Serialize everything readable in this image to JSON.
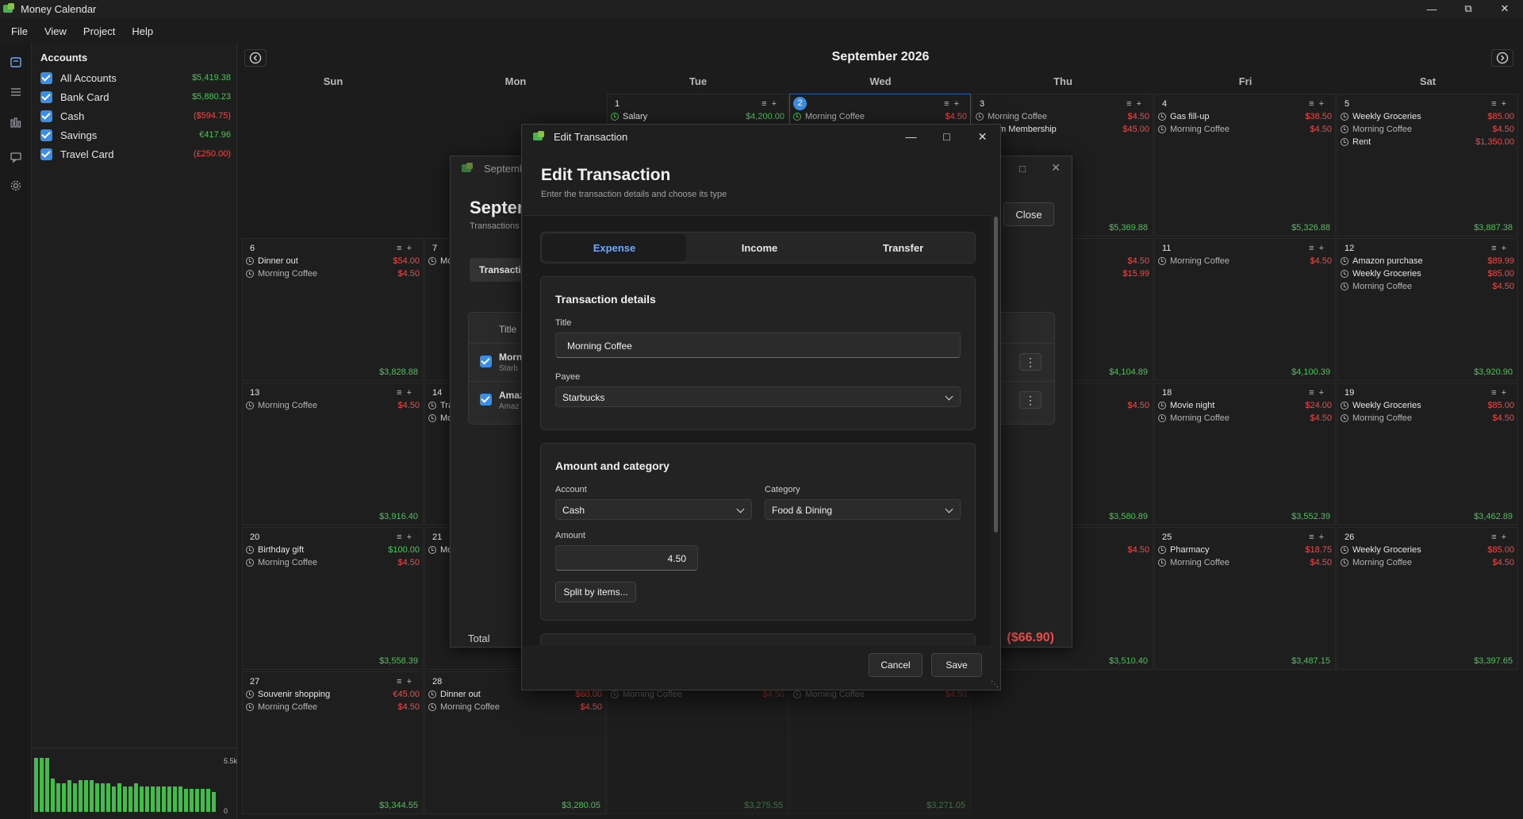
{
  "app": {
    "title": "Money Calendar"
  },
  "menu": [
    "File",
    "View",
    "Project",
    "Help"
  ],
  "rail_icons": [
    "calendar-icon",
    "list-icon",
    "chart-icon",
    "chat-icon",
    "settings-icon"
  ],
  "accounts": {
    "header": "Accounts",
    "items": [
      {
        "name": "All Accounts",
        "balance": "$5,419.38",
        "status": "pos"
      },
      {
        "name": "Bank Card",
        "balance": "$5,880.23",
        "status": "pos"
      },
      {
        "name": "Cash",
        "balance": "($594.75)",
        "status": "neg"
      },
      {
        "name": "Savings",
        "balance": "€417.96",
        "status": "pos"
      },
      {
        "name": "Travel Card",
        "balance": "(£250.00)",
        "status": "neg"
      }
    ],
    "mini_chart": {
      "top_label": "5.5k",
      "bottom_label": "0",
      "values": [
        0.94,
        0.94,
        0.94,
        0.58,
        0.5,
        0.5,
        0.55,
        0.5,
        0.55,
        0.55,
        0.55,
        0.5,
        0.5,
        0.5,
        0.45,
        0.5,
        0.45,
        0.45,
        0.5,
        0.45,
        0.45,
        0.45,
        0.45,
        0.45,
        0.45,
        0.45,
        0.45,
        0.4,
        0.4,
        0.4,
        0.4,
        0.4,
        0.35
      ]
    }
  },
  "calendar": {
    "month_title": "September 2026",
    "days_of_week": [
      "Sun",
      "Mon",
      "Tue",
      "Wed",
      "Thu",
      "Fri",
      "Sat"
    ],
    "weeks": [
      [
        null,
        null,
        {
          "day": "1",
          "tx": [
            {
              "t": "Salary",
              "a": "$4,200.00",
              "s": "pos",
              "done": true
            }
          ],
          "bal": ""
        },
        {
          "day": "2",
          "today": true,
          "tx": [
            {
              "t": "Morning Coffee",
              "a": "$4.50",
              "s": "neg",
              "done": true
            }
          ],
          "bal": ""
        },
        {
          "day": "3",
          "tx": [
            {
              "t": "Morning Coffee",
              "a": "$4.50",
              "s": "neg"
            },
            {
              "t": "Gym Membership",
              "a": "$45.00",
              "s": "neg"
            }
          ],
          "bal": "$5,369.88"
        },
        {
          "day": "4",
          "tx": [
            {
              "t": "Gas fill-up",
              "a": "$38.50",
              "s": "neg"
            },
            {
              "t": "Morning Coffee",
              "a": "$4.50",
              "s": "neg"
            }
          ],
          "bal": "$5,326.88"
        },
        {
          "day": "5",
          "tx": [
            {
              "t": "Weekly Groceries",
              "a": "$85.00",
              "s": "neg"
            },
            {
              "t": "Morning Coffee",
              "a": "$4.50",
              "s": "neg"
            },
            {
              "t": "Rent",
              "a": "$1,350.00",
              "s": "neg"
            }
          ],
          "bal": "$3,887.38"
        }
      ],
      [
        {
          "day": "6",
          "tx": [
            {
              "t": "Dinner out",
              "a": "$54.00",
              "s": "neg"
            },
            {
              "t": "Morning Coffee",
              "a": "$4.50",
              "s": "neg"
            }
          ],
          "bal": "$3,828.88"
        },
        {
          "day": "7",
          "tx": [
            {
              "t": "Mo",
              "a": "",
              "s": "neg"
            }
          ],
          "bal": ""
        },
        null,
        null,
        {
          "day": "",
          "tx": [
            {
              "t": "",
              "a": "$4.50",
              "s": "neg"
            },
            {
              "t": "n",
              "a": "$15.99",
              "s": "neg"
            }
          ],
          "bal": "$4,104.89"
        },
        {
          "day": "11",
          "tx": [
            {
              "t": "Morning Coffee",
              "a": "$4.50",
              "s": "neg"
            }
          ],
          "bal": "$4,100.39"
        },
        {
          "day": "12",
          "tx": [
            {
              "t": "Amazon purchase",
              "a": "$89.99",
              "s": "neg"
            },
            {
              "t": "Weekly Groceries",
              "a": "$85.00",
              "s": "neg"
            },
            {
              "t": "Morning Coffee",
              "a": "$4.50",
              "s": "neg"
            }
          ],
          "bal": "$3,920.90"
        }
      ],
      [
        {
          "day": "13",
          "tx": [
            {
              "t": "Morning Coffee",
              "a": "$4.50",
              "s": "neg"
            }
          ],
          "bal": "$3,916.40"
        },
        {
          "day": "14",
          "tx": [
            {
              "t": "Tra",
              "a": "",
              "s": "neg"
            },
            {
              "t": "Mo",
              "a": "",
              "s": "neg"
            }
          ],
          "bal": ""
        },
        null,
        null,
        {
          "day": "",
          "tx": [
            {
              "t": "",
              "a": "$4.50",
              "s": "neg"
            }
          ],
          "bal": "$3,580.89"
        },
        {
          "day": "18",
          "tx": [
            {
              "t": "Movie night",
              "a": "$24.00",
              "s": "neg"
            },
            {
              "t": "Morning Coffee",
              "a": "$4.50",
              "s": "neg"
            }
          ],
          "bal": "$3,552.39"
        },
        {
          "day": "19",
          "tx": [
            {
              "t": "Weekly Groceries",
              "a": "$85.00",
              "s": "neg"
            },
            {
              "t": "Morning Coffee",
              "a": "$4.50",
              "s": "neg"
            }
          ],
          "bal": "$3,462.89"
        }
      ],
      [
        {
          "day": "20",
          "tx": [
            {
              "t": "Birthday gift",
              "a": "$100.00",
              "s": "pos"
            },
            {
              "t": "Morning Coffee",
              "a": "$4.50",
              "s": "neg"
            }
          ],
          "bal": "$3,558.39"
        },
        {
          "day": "21",
          "tx": [
            {
              "t": "Mo",
              "a": "",
              "s": "neg"
            }
          ],
          "bal": ""
        },
        null,
        null,
        {
          "day": "",
          "tx": [
            {
              "t": "",
              "a": "$4.50",
              "s": "neg"
            }
          ],
          "bal": "$3,510.40"
        },
        {
          "day": "25",
          "tx": [
            {
              "t": "Pharmacy",
              "a": "$18.75",
              "s": "neg"
            },
            {
              "t": "Morning Coffee",
              "a": "$4.50",
              "s": "neg"
            }
          ],
          "bal": "$3,487.15"
        },
        {
          "day": "26",
          "tx": [
            {
              "t": "Weekly Groceries",
              "a": "$85.00",
              "s": "neg"
            },
            {
              "t": "Morning Coffee",
              "a": "$4.50",
              "s": "neg"
            }
          ],
          "bal": "$3,397.65"
        }
      ],
      [
        {
          "day": "27",
          "tx": [
            {
              "t": "Souvenir shopping",
              "a": "€45.00",
              "s": "neg"
            },
            {
              "t": "Morning Coffee",
              "a": "$4.50",
              "s": "neg"
            }
          ],
          "bal": "$3,344.55"
        },
        {
          "day": "28",
          "tx": [
            {
              "t": "Dinner out",
              "a": "$60.00",
              "s": "neg"
            },
            {
              "t": "Morning Coffee",
              "a": "$4.50",
              "s": "neg"
            }
          ],
          "bal": "$3,280.05"
        },
        {
          "day": "",
          "faded": true,
          "tx": [
            {
              "t": "Morning Coffee",
              "a": "$4.50",
              "s": "neg"
            }
          ],
          "bal": "$3,275.55"
        },
        {
          "day": "",
          "faded": true,
          "tx": [
            {
              "t": "Morning Coffee",
              "a": "$4.50",
              "s": "neg"
            }
          ],
          "bal": "$3,271.05"
        },
        null,
        null,
        null
      ]
    ]
  },
  "bg_dialog": {
    "title": "September",
    "heading": "Septem",
    "subtitle": "Transactions a",
    "tab_label": "Transacti",
    "close_label": "Close",
    "table_header": "Title",
    "rows": [
      {
        "title": "Morn",
        "sub": "Starb"
      },
      {
        "title": "Amaz",
        "sub": "Amaz"
      }
    ],
    "total_label": "Total",
    "total_value": "($66.90)"
  },
  "edit_dialog": {
    "window_title": "Edit Transaction",
    "heading": "Edit Transaction",
    "subtitle": "Enter the transaction details and choose its type",
    "tabs": [
      "Expense",
      "Income",
      "Transfer"
    ],
    "active_tab": "Expense",
    "details": {
      "section_title": "Transaction details",
      "title_label": "Title",
      "title_value": "Morning Coffee",
      "payee_label": "Payee",
      "payee_value": "Starbucks"
    },
    "amount": {
      "section_title": "Amount and category",
      "account_label": "Account",
      "account_value": "Cash",
      "category_label": "Category",
      "category_value": "Food & Dining",
      "amount_label": "Amount",
      "amount_value": "4.50",
      "split_label": "Split by items..."
    },
    "cancel_label": "Cancel",
    "save_label": "Save"
  },
  "colors": {
    "accent": "#3a8ee6",
    "positive": "#4cc35a",
    "negative": "#ef4a4a"
  }
}
